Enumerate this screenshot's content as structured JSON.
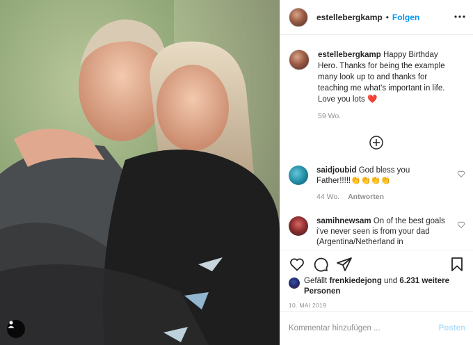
{
  "header": {
    "username": "estellebergkamp",
    "separator": "•",
    "follow_label": "Folgen",
    "more_icon": "more-horizontal-icon"
  },
  "caption": {
    "username": "estellebergkamp",
    "text": " Happy Birthday Hero. Thanks for being the example many look up to and thanks for teaching me what's important in life. Love you lots ",
    "emoji": "❤️",
    "time": "59 Wo."
  },
  "load_more_icon": "plus-circle-icon",
  "comments": [
    {
      "username": "saidjoubid",
      "text": " God bless you Father!!!!!👏👏👏👏",
      "time": "44 Wo.",
      "reply_label": "Antworten"
    },
    {
      "username": "samihnewsam",
      "text": " On of the best goals i've never seen is from your dad (Argentina/Netherland in"
    }
  ],
  "actions": {
    "like_icon": "heart-icon",
    "comment_icon": "comment-icon",
    "share_icon": "send-icon",
    "save_icon": "bookmark-icon"
  },
  "likes": {
    "prefix": "Gefällt ",
    "user": "frenkiedejong",
    "middle": " und ",
    "count": "6.231 weitere Personen"
  },
  "date": "10. MAI 2019",
  "add_comment": {
    "placeholder": "Kommentar hinzufügen ...",
    "post_label": "Posten"
  },
  "colors": {
    "accent": "#0095f6",
    "post_disabled": "#b2dffc",
    "muted": "#8e8e8e"
  }
}
